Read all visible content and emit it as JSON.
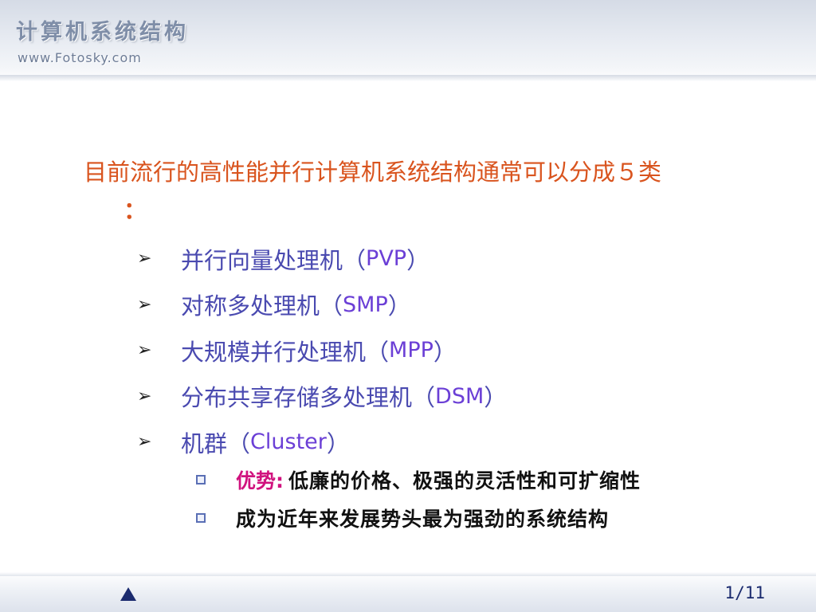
{
  "header": {
    "title": "计算机系统结构",
    "url": "www.Fotosky.com"
  },
  "intro": {
    "text": "目前流行的高性能并行计算机系统结构通常可以分成５类",
    "colon": "："
  },
  "items": [
    {
      "text": "并行向量处理机",
      "open": "（ ",
      "abbr": "PVP",
      "close": " ）"
    },
    {
      "text": "对称多处理机",
      "open": "（ ",
      "abbr": "SMP",
      "close": " ）"
    },
    {
      "text": "大规模并行处理机",
      "open": "（ ",
      "abbr": "MPP",
      "close": " ）"
    },
    {
      "text": "分布共享存储多处理机",
      "open": "（ ",
      "abbr": "DSM",
      "close": " ）"
    },
    {
      "text": "机群",
      "open": "（ ",
      "abbr": "Cluster",
      "close": " ）"
    }
  ],
  "subitems": [
    {
      "label": "优势:",
      "text": "低廉的价格、极强的灵活性和可扩缩性"
    },
    {
      "label": "",
      "text": "成为近年来发展势头最为强劲的系统结构"
    }
  ],
  "footer": {
    "page": "1/11"
  },
  "icons": {
    "bullet": "arrow-right-icon",
    "sub_bullet": "square-bullet-icon",
    "nav": "triangle-up-icon"
  },
  "colors": {
    "intro": "#d9541e",
    "item_text": "#4a4ab0",
    "item_abbr": "#6b3fd6",
    "highlight": "#d0127e",
    "nav": "#1a2a6e"
  }
}
